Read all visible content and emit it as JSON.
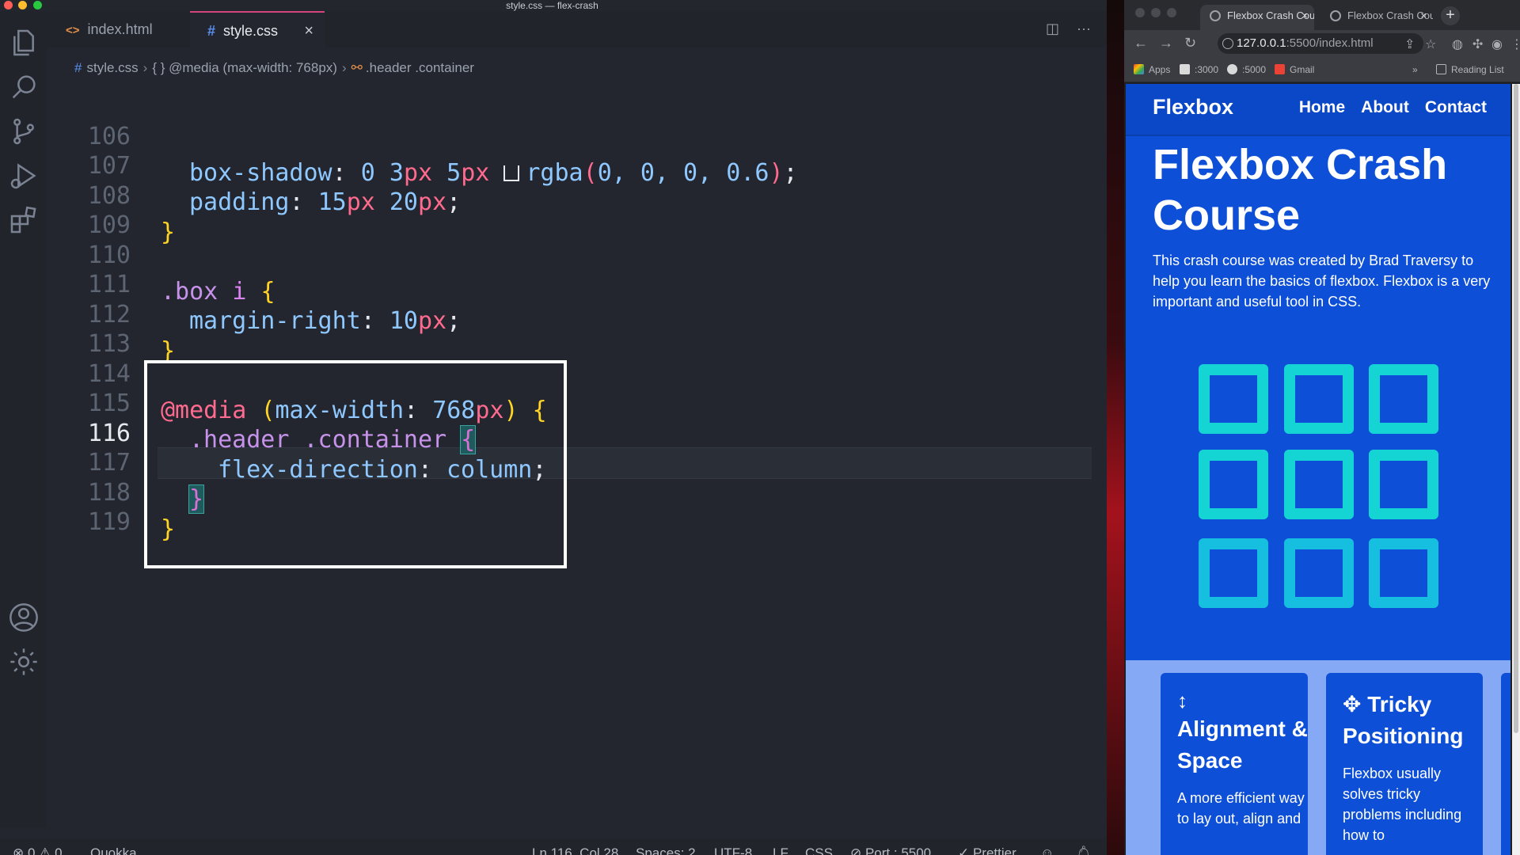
{
  "window": {
    "title": "style.css — flex-crash"
  },
  "editor": {
    "tabs": [
      {
        "label": "index.html",
        "icon": "<>"
      },
      {
        "label": "style.css",
        "icon": "#"
      }
    ],
    "breadcrumb": {
      "file": "style.css",
      "media": "{ } @media (max-width: 768px)",
      "selector": ".header .container"
    },
    "line_numbers": [
      "106",
      "107",
      "108",
      "109",
      "110",
      "111",
      "112",
      "113",
      "114",
      "115",
      "116",
      "117",
      "118",
      "119"
    ],
    "code": {
      "l106_prop": "box-shadow",
      "l106_v1": "0",
      "l106_v2": "3",
      "l106_v3": "5",
      "l106_fn": "rgba",
      "l106_args": "0, 0, 0, 0.6",
      "l107_prop": "padding",
      "l107_v1": "15",
      "l107_v2": "20",
      "l110_sel": ".box",
      "l110_el": "i",
      "l111_prop": "margin-right",
      "l111_v1": "10",
      "l114_at": "@media",
      "l114_cond_prop": "max-width",
      "l114_cond_val": "768",
      "l115_sel": ".header .container",
      "l116_prop": "flex-direction",
      "l116_val": "column",
      "unit_px": "px",
      "brace_open": "{",
      "brace_close": "}"
    }
  },
  "status": {
    "errors": "0",
    "warnings": "0",
    "quokka": "Quokka",
    "cursor": "Ln 116, Col 28",
    "spaces": "Spaces: 2",
    "encoding": "UTF-8",
    "eol": "LF",
    "language": "CSS",
    "port": "Port : 5500",
    "prettier": "Prettier"
  },
  "browser": {
    "tabs": [
      {
        "label": "Flexbox Crash Course"
      },
      {
        "label": "Flexbox Crash Course"
      }
    ],
    "url_host": "127.0.0.1",
    "url_path": ":5500/index.html",
    "bookmarks": [
      "Apps",
      ":3000",
      ":5000",
      "Gmail"
    ],
    "reading_list": "Reading List",
    "bookmarks_more": "»"
  },
  "site": {
    "logo": "Flexbox",
    "nav": [
      "Home",
      "About",
      "Contact"
    ],
    "hero_title": "Flexbox Crash Course",
    "hero_text": "This crash course was created by Brad Traversy to help you learn the basics of flexbox. Flexbox is a very important and useful tool in CSS.",
    "cards": [
      {
        "icon": "↕",
        "title": "Alignment & Space",
        "text": "A more efficient way to lay out, align and"
      },
      {
        "icon": "✥",
        "title": "Tricky Positioning",
        "text": "Flexbox usually solves tricky problems including how to"
      }
    ]
  },
  "colors": {
    "accent": "#0d4fd6",
    "box_border": "#14d4d4",
    "editor_bg": "#23262e"
  }
}
